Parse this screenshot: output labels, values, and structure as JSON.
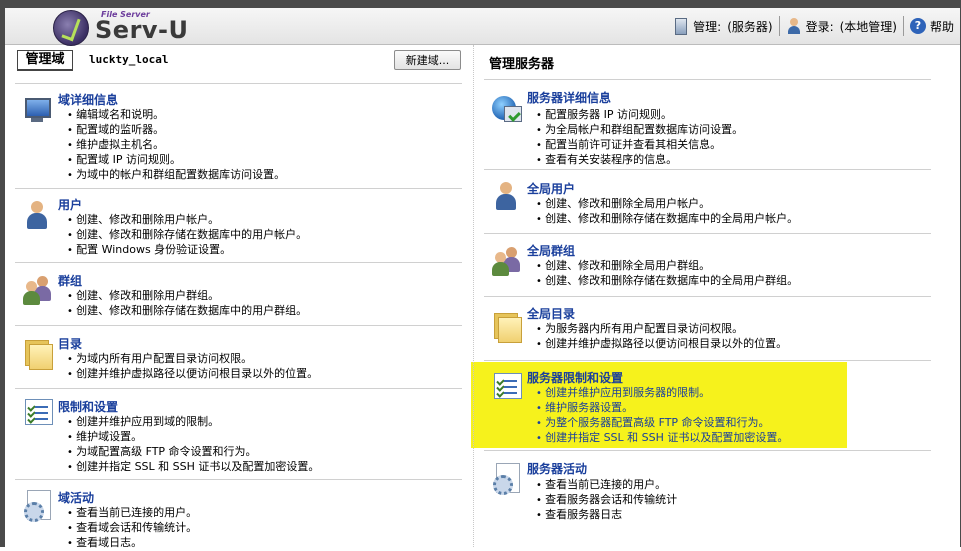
{
  "header": {
    "logo_small": "File Server",
    "logo_text": "Serv-U",
    "manage_label": "管理:",
    "manage_value": "(服务器)",
    "login_label": "登录:",
    "login_value": "(本地管理)",
    "help_label": "帮助"
  },
  "left": {
    "domain_tab": "管理域",
    "domain_name": "luckty_local",
    "new_domain_button": "新建域...",
    "sections": [
      {
        "title": "域详细信息",
        "icon": "monitor-icon",
        "items": [
          "编辑域名和说明。",
          "配置域的监听器。",
          "维护虚拟主机名。",
          "配置域 IP 访问规则。",
          "为域中的帐户和群组配置数据库访问设置。"
        ]
      },
      {
        "title": "用户",
        "icon": "user-icon",
        "items": [
          "创建、修改和删除用户帐户。",
          "创建、修改和删除存储在数据库中的用户帐户。",
          "配置 Windows 身份验证设置。"
        ]
      },
      {
        "title": "群组",
        "icon": "group-icon",
        "items": [
          "创建、修改和删除用户群组。",
          "创建、修改和删除存储在数据库中的用户群组。"
        ]
      },
      {
        "title": "目录",
        "icon": "folder-icon",
        "items": [
          "为域内所有用户配置目录访问权限。",
          "创建并维护虚拟路径以便访问根目录以外的位置。"
        ]
      },
      {
        "title": "限制和设置",
        "icon": "checklist-icon",
        "items": [
          "创建并维护应用到域的限制。",
          "维护域设置。",
          "为域配置高级 FTP 命令设置和行为。",
          "创建并指定 SSL 和 SSH 证书以及配置加密设置。"
        ]
      },
      {
        "title": "域活动",
        "icon": "activity-icon",
        "items": [
          "查看当前已连接的用户。",
          "查看域会话和传输统计。",
          "查看域日志。"
        ]
      }
    ]
  },
  "right": {
    "title": "管理服务器",
    "sections": [
      {
        "title": "服务器详细信息",
        "icon": "server-globe-icon",
        "items": [
          "配置服务器 IP 访问规则。",
          "为全局帐户和群组配置数据库访问设置。",
          "配置当前许可证并查看其相关信息。",
          "查看有关安装程序的信息。"
        ]
      },
      {
        "title": "全局用户",
        "icon": "user-icon",
        "items": [
          "创建、修改和删除全局用户帐户。",
          "创建、修改和删除存储在数据库中的全局用户帐户。"
        ]
      },
      {
        "title": "全局群组",
        "icon": "group-icon",
        "items": [
          "创建、修改和删除全局用户群组。",
          "创建、修改和删除存储在数据库中的全局用户群组。"
        ]
      },
      {
        "title": "全局目录",
        "icon": "folder-icon",
        "items": [
          "为服务器内所有用户配置目录访问权限。",
          "创建并维护虚拟路径以便访问根目录以外的位置。"
        ]
      },
      {
        "title": "服务器限制和设置",
        "icon": "checklist-icon",
        "items": [
          "创建并维护应用到服务器的限制。",
          "维护服务器设置。",
          "为整个服务器配置高级 FTP 命令设置和行为。",
          "创建并指定 SSL 和 SSH 证书以及配置加密设置。"
        ]
      },
      {
        "title": "服务器活动",
        "icon": "activity-icon",
        "items": [
          "查看当前已连接的用户。",
          "查看服务器会话和传输统计",
          "查看服务器日志"
        ]
      }
    ]
  },
  "colors": {
    "link_blue": "#1a3f9c",
    "highlight_yellow": "#f6f21c",
    "frame_dark": "#4a4a4a"
  }
}
